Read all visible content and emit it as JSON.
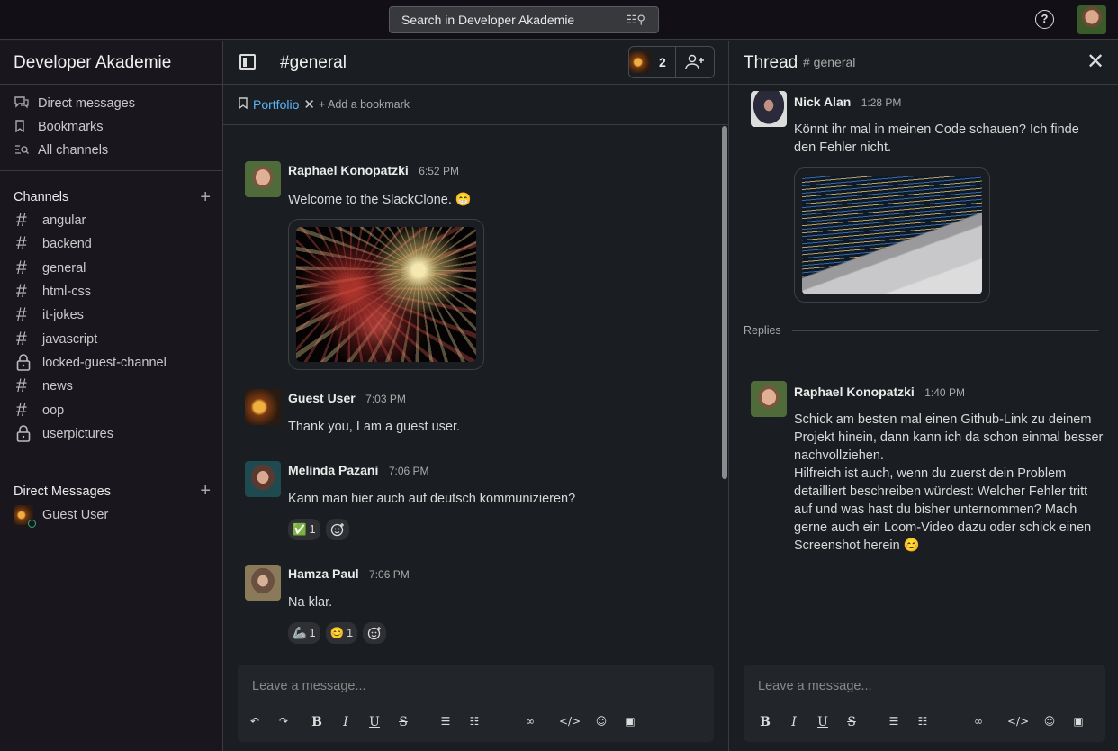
{
  "topbar": {
    "search_placeholder": "Search in Developer Akademie",
    "search_icons": "☷⚲",
    "help_label": "?"
  },
  "sidebar": {
    "workspace": "Developer Akademie",
    "nav": [
      {
        "label": "Direct messages",
        "icon": "messages-icon"
      },
      {
        "label": "Bookmarks",
        "icon": "bookmark-icon"
      },
      {
        "label": "All channels",
        "icon": "channels-search-icon"
      }
    ],
    "channels_title": "Channels",
    "channels": [
      {
        "name": "angular",
        "locked": false
      },
      {
        "name": "backend",
        "locked": false
      },
      {
        "name": "general",
        "locked": false
      },
      {
        "name": "html-css",
        "locked": false
      },
      {
        "name": "it-jokes",
        "locked": false
      },
      {
        "name": "javascript",
        "locked": false
      },
      {
        "name": "locked-guest-channel",
        "locked": true
      },
      {
        "name": "news",
        "locked": false
      },
      {
        "name": "oop",
        "locked": false
      },
      {
        "name": "userpictures",
        "locked": true
      }
    ],
    "dm_title": "Direct Messages",
    "dms": [
      {
        "name": "Guest User",
        "status": "online"
      }
    ]
  },
  "channel": {
    "title": "#general",
    "member_count": "2",
    "bookmark_link": "Portfolio",
    "add_bookmark": "+ Add a bookmark",
    "messages": [
      {
        "author": "Raphael Konopatzki",
        "time": "6:52 PM",
        "text": "Welcome to the SlackClone. 😁",
        "has_image": true
      },
      {
        "author": "Guest User",
        "time": "7:03 PM",
        "text": "Thank you, I am a guest user."
      },
      {
        "author": "Melinda Pazani",
        "time": "7:06 PM",
        "text": "Kann man hier auch auf deutsch kommunizieren?",
        "reactions": [
          {
            "emoji": "✅",
            "count": "1"
          }
        ]
      },
      {
        "author": "Hamza Paul",
        "time": "7:06 PM",
        "text": "Na klar.",
        "reactions": [
          {
            "emoji": "🦾",
            "count": "1"
          },
          {
            "emoji": "😊",
            "count": "1"
          }
        ]
      }
    ],
    "composer_placeholder": "Leave a message..."
  },
  "thread": {
    "title": "Thread",
    "channel": "# general",
    "parent": {
      "author": "Nick Alan",
      "time": "1:28 PM",
      "text": "Könnt ihr mal in meinen Code schauen? Ich finde den Fehler nicht."
    },
    "replies_label": "Replies",
    "reply": {
      "author": "Raphael Konopatzki",
      "time": "1:40 PM",
      "text1": "Schick am besten mal einen Github-Link zu deinem Projekt hinein, dann kann ich da schon einmal besser nachvollziehen.",
      "text2": "Hilfreich ist auch, wenn du zuerst dein Problem detailliert beschreiben würdest: Welcher Fehler tritt auf und was hast du bisher unternommen? Mach gerne auch ein Loom-Video dazu oder schick einen Screenshot herein 😊"
    },
    "composer_placeholder": "Leave a message..."
  },
  "colors": {
    "accent_link": "#5eb5f7",
    "online": "#2bac76",
    "bg": "#1a1d21",
    "sidebar_bg": "#19171d"
  }
}
